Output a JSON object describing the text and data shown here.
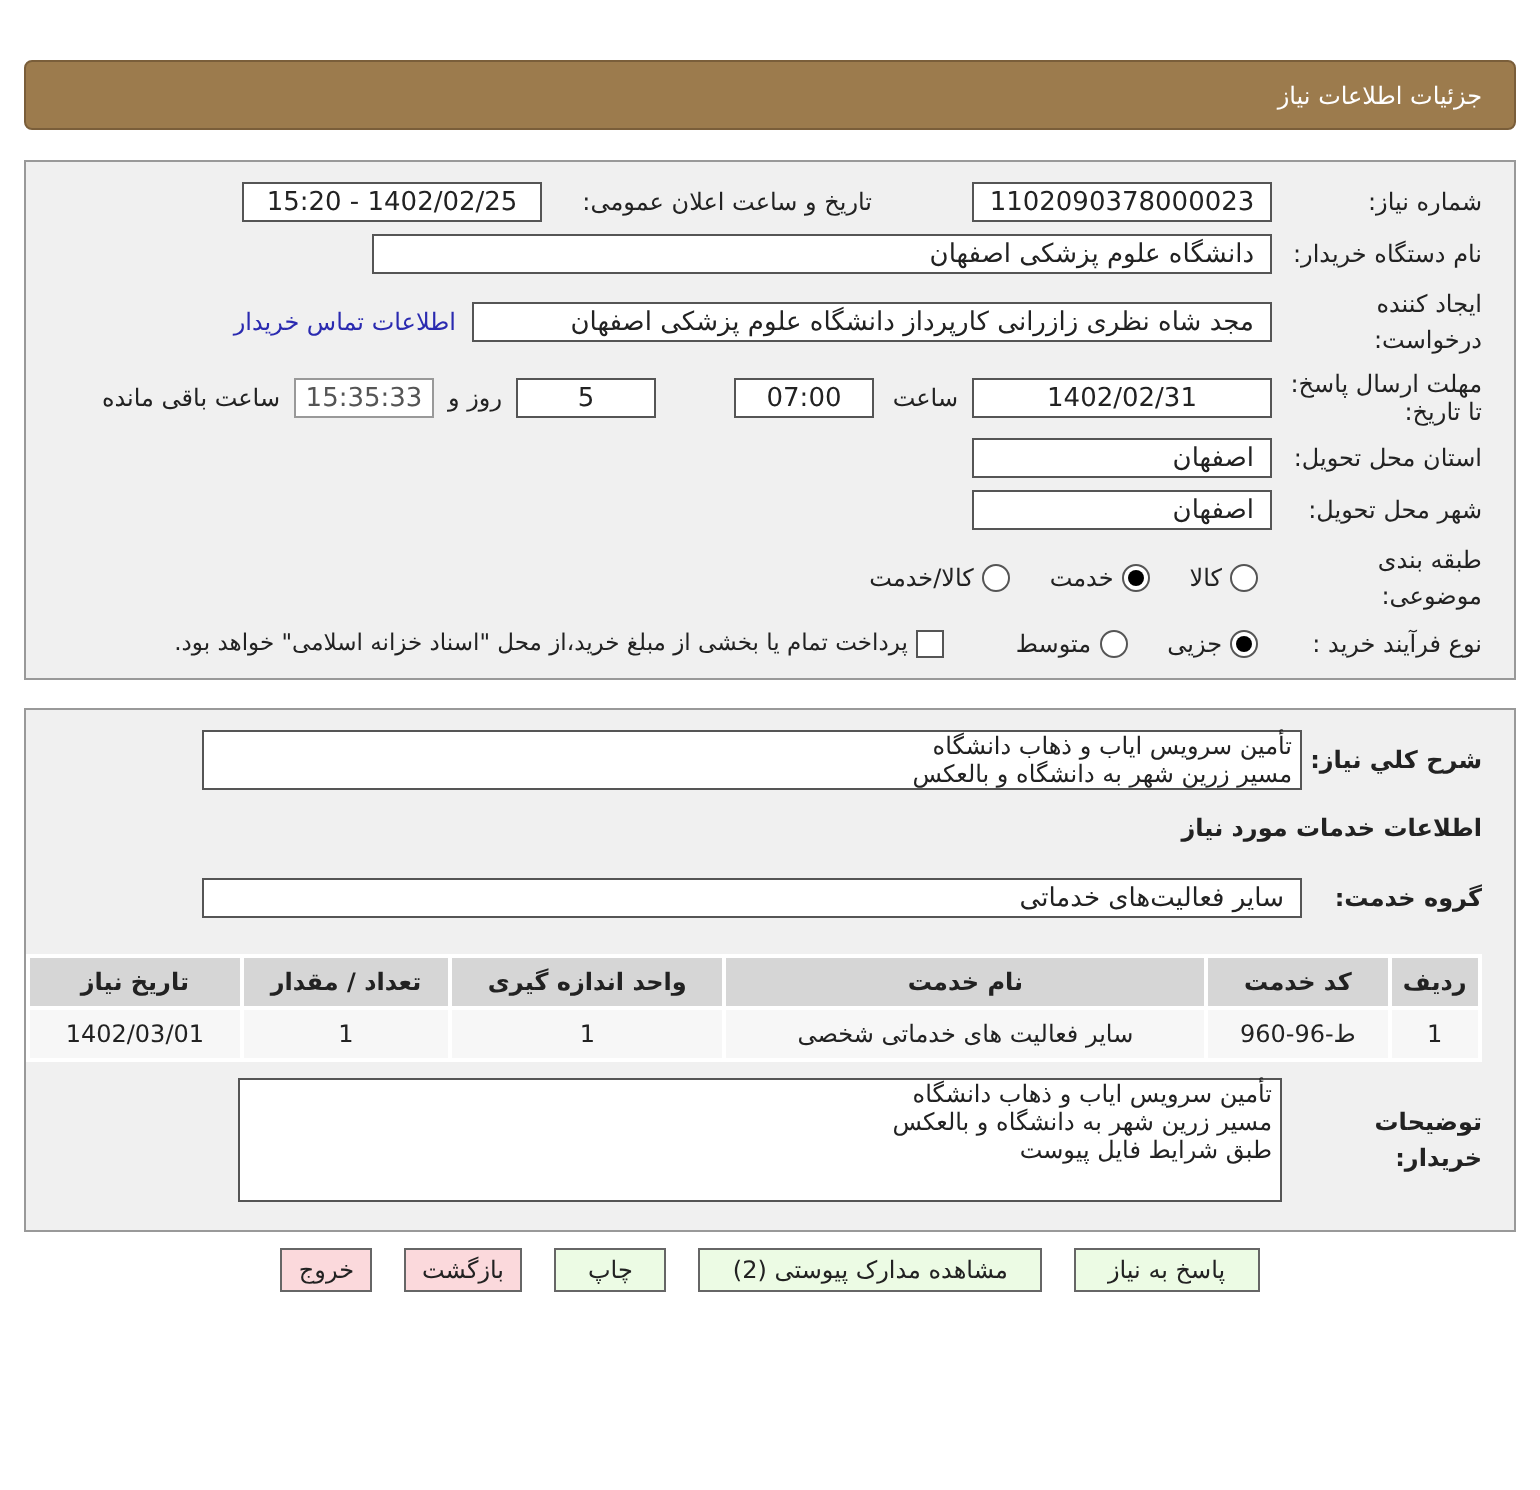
{
  "header": {
    "title": "جزئیات اطلاعات نیاز"
  },
  "details": {
    "need_number": {
      "label": "شماره نیاز:",
      "value": "1102090378000023"
    },
    "announce": {
      "label": "تاریخ و ساعت اعلان عمومی:",
      "value": "1402/02/25 - 15:20"
    },
    "buyer": {
      "label": "نام دستگاه خریدار:",
      "value": "دانشگاه علوم پزشکی اصفهان"
    },
    "creator": {
      "label": "ایجاد کننده درخواست:",
      "value": "مجد شاه نظری زازرانی کارپرداز دانشگاه علوم پزشکی اصفهان",
      "link": "اطلاعات تماس خریدار"
    },
    "deadline": {
      "label": "مهلت ارسال پاسخ: تا تاریخ:",
      "date": "1402/02/31",
      "time_label": "ساعت",
      "time": "07:00",
      "days": "5",
      "days_label": "روز و",
      "remaining": "15:35:33",
      "remaining_label": "ساعت باقی مانده"
    },
    "province": {
      "label": "استان محل تحویل:",
      "value": "اصفهان"
    },
    "city": {
      "label": "شهر محل تحویل:",
      "value": "اصفهان"
    },
    "category": {
      "label": "طبقه بندی موضوعی:",
      "options": [
        {
          "label": "کالا",
          "selected": false
        },
        {
          "label": "خدمت",
          "selected": true
        },
        {
          "label": "کالا/خدمت",
          "selected": false
        }
      ]
    },
    "process": {
      "label": "نوع فرآیند خرید :",
      "options": [
        {
          "label": "جزیی",
          "selected": true
        },
        {
          "label": "متوسط",
          "selected": false
        }
      ],
      "payment": {
        "label": "پرداخت تمام یا بخشی از مبلغ خرید،از محل \"اسناد خزانه اسلامی\" خواهد بود.",
        "checked": false
      }
    }
  },
  "needs": {
    "summary_label": "شرح کلي نیاز:",
    "summary": [
      "تأمین سرویس ایاب و ذهاب دانشگاه",
      "مسیر زرین شهر به دانشگاه و بالعکس"
    ],
    "section_title": "اطلاعات خدمات مورد نیاز",
    "group_label": "گروه خدمت:",
    "group": "سایر فعالیت‌های خدماتی",
    "table": {
      "columns": [
        "ردیف",
        "کد خدمت",
        "نام خدمت",
        "واحد اندازه گیری",
        "تعداد / مقدار",
        "تاریخ نیاز"
      ],
      "rows": [
        [
          "1",
          "ط-96-960",
          "سایر فعالیت های خدماتی شخصی",
          "1",
          "1",
          "1402/03/01"
        ]
      ]
    },
    "notes_label": "توضیحات خریدار:",
    "notes": [
      "تأمین سرویس ایاب و ذهاب دانشگاه",
      "مسیر زرین شهر به دانشگاه و بالعکس",
      "طبق شرایط فایل پیوست"
    ]
  },
  "buttons": [
    {
      "label": "پاسخ به نیاز",
      "kind": "action"
    },
    {
      "label": "مشاهده مدارک پیوستی (2)",
      "kind": "action"
    },
    {
      "label": "چاپ",
      "kind": "action"
    },
    {
      "label": "بازگشت",
      "kind": "exit"
    },
    {
      "label": "خروج",
      "kind": "exit"
    }
  ]
}
